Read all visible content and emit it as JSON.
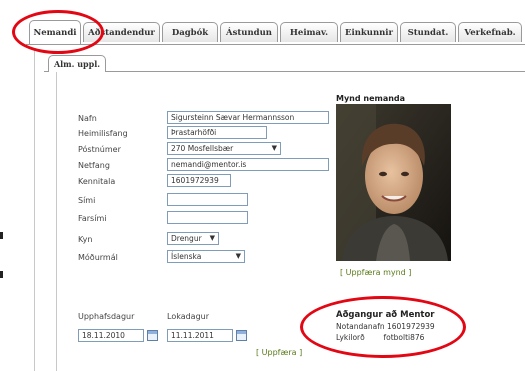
{
  "tabs": [
    {
      "label": "Nemandi",
      "active": true
    },
    {
      "label": "Aðstandendur",
      "active": false
    },
    {
      "label": "Dagbók",
      "active": false
    },
    {
      "label": "Ástundun",
      "active": false
    },
    {
      "label": "Heimav.",
      "active": false
    },
    {
      "label": "Einkunnir",
      "active": false
    },
    {
      "label": "Stundat.",
      "active": false
    },
    {
      "label": "Verkefnab.",
      "active": false
    }
  ],
  "subtab": {
    "label": "Alm. uppl."
  },
  "form": {
    "name": {
      "label": "Nafn",
      "value": "Sigursteinn Sævar Hermannsson"
    },
    "address": {
      "label": "Heimilisfang",
      "value": "Þrastarhöfði"
    },
    "postcode": {
      "label": "Póstnúmer",
      "value": "270 Mosfellsbær"
    },
    "email": {
      "label": "Netfang",
      "value": "nemandi@mentor.is"
    },
    "kennitala": {
      "label": "Kennitala",
      "value": "1601972939"
    },
    "phone": {
      "label": "Sími",
      "value": ""
    },
    "mobile": {
      "label": "Farsími",
      "value": ""
    },
    "gender": {
      "label": "Kyn",
      "value": "Drengur"
    },
    "language": {
      "label": "Móðurmál",
      "value": "Íslenska"
    }
  },
  "photo": {
    "title": "Mynd nemanda",
    "update_link": "[ Uppfæra mynd ]"
  },
  "dates": {
    "start": {
      "label": "Upphafsdagur",
      "value": "18.11.2010"
    },
    "end": {
      "label": "Lokadagur",
      "value": "11.11.2011"
    },
    "update_link": "[ Uppfæra ]"
  },
  "access": {
    "title": "Aðgangur að Mentor",
    "username_label": "Notandanafn",
    "username": "1601972939",
    "password_label": "Lykilorð",
    "password": "fotbolti876"
  },
  "colors": {
    "highlight": "#e30613",
    "link": "#5a7a1a",
    "input_border": "#7f9db9"
  }
}
